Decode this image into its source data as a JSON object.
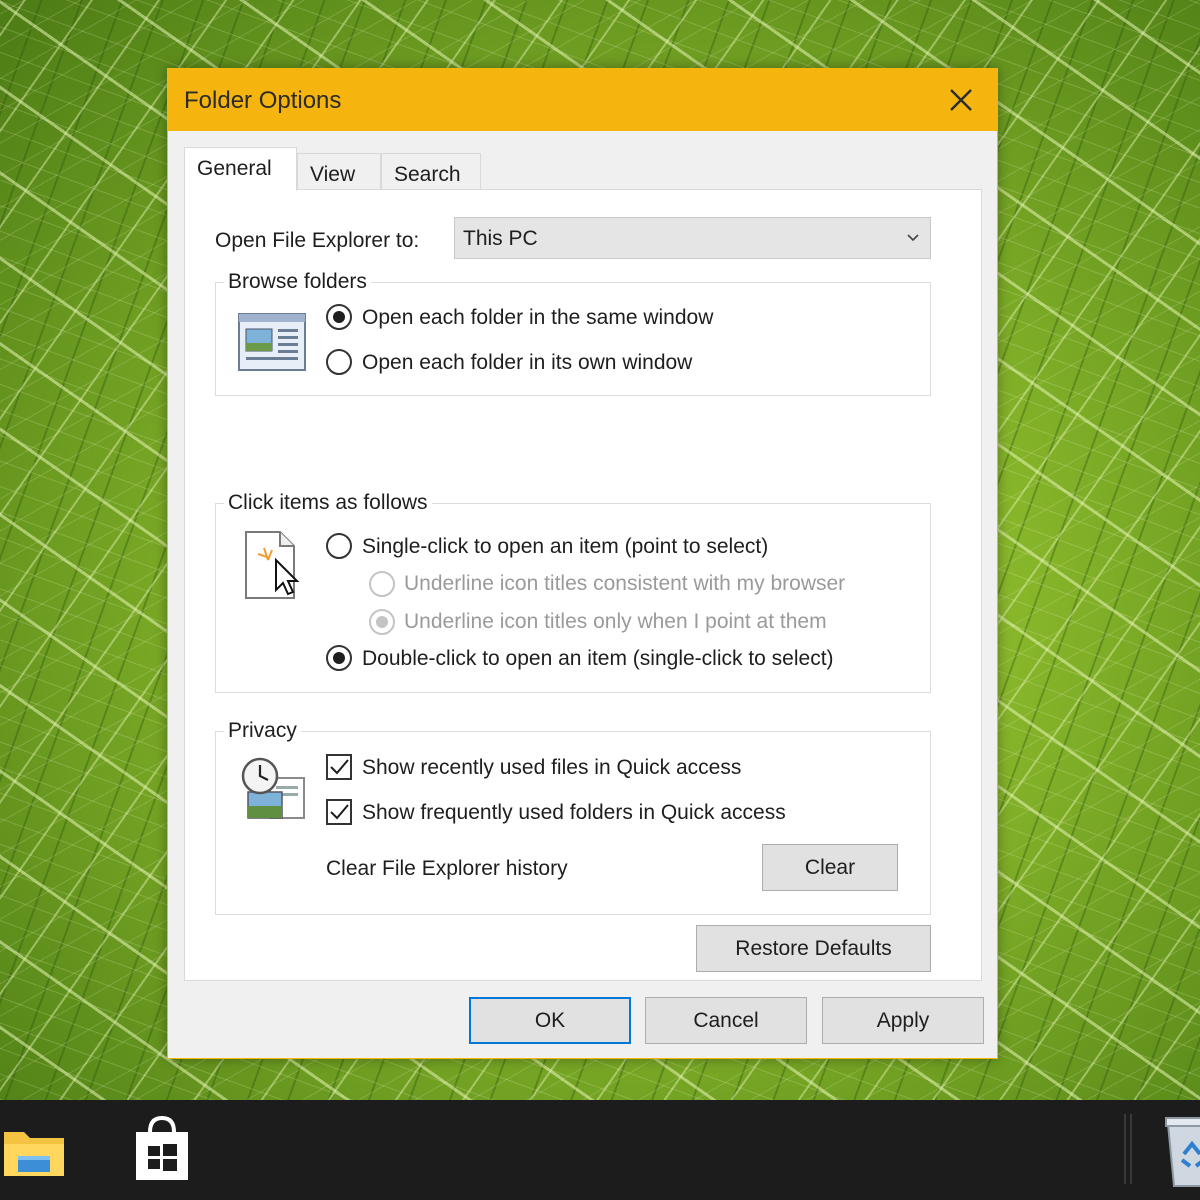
{
  "dialog": {
    "title": "Folder Options",
    "tabs": [
      {
        "label": "General",
        "active": true
      },
      {
        "label": "View",
        "active": false
      },
      {
        "label": "Search",
        "active": false
      }
    ],
    "open_explorer": {
      "label": "Open File Explorer to:",
      "value": "This PC"
    },
    "browse_folders": {
      "title": "Browse folders",
      "options": [
        {
          "label": "Open each folder in the same window",
          "checked": true
        },
        {
          "label": "Open each folder in its own window",
          "checked": false
        }
      ]
    },
    "click_items": {
      "title": "Click items as follows",
      "single_click": {
        "label": "Single-click to open an item (point to select)",
        "checked": false
      },
      "underline_browser": {
        "label": "Underline icon titles consistent with my browser",
        "checked": false,
        "disabled": true
      },
      "underline_point": {
        "label": "Underline icon titles only when I point at them",
        "checked": true,
        "disabled": true
      },
      "double_click": {
        "label": "Double-click to open an item (single-click to select)",
        "checked": true
      }
    },
    "privacy": {
      "title": "Privacy",
      "recent_files": {
        "label": "Show recently used files in Quick access",
        "checked": true
      },
      "frequent_folders": {
        "label": "Show frequently used folders in Quick access",
        "checked": true
      },
      "clear_history_label": "Clear File Explorer history",
      "clear_button": "Clear"
    },
    "restore_defaults": "Restore Defaults",
    "buttons": {
      "ok": "OK",
      "cancel": "Cancel",
      "apply": "Apply"
    }
  },
  "colors": {
    "title_bar": "#f6b40e",
    "dialog_bg": "#f0f0f0",
    "panel_bg": "#ffffff",
    "default_button_border": "#0078d7",
    "taskbar": "#1c1c1c"
  },
  "taskbar": {
    "items": [
      {
        "icon": "file-explorer-icon"
      },
      {
        "icon": "store-icon"
      },
      {
        "icon": "recycle-bin-icon"
      }
    ]
  }
}
